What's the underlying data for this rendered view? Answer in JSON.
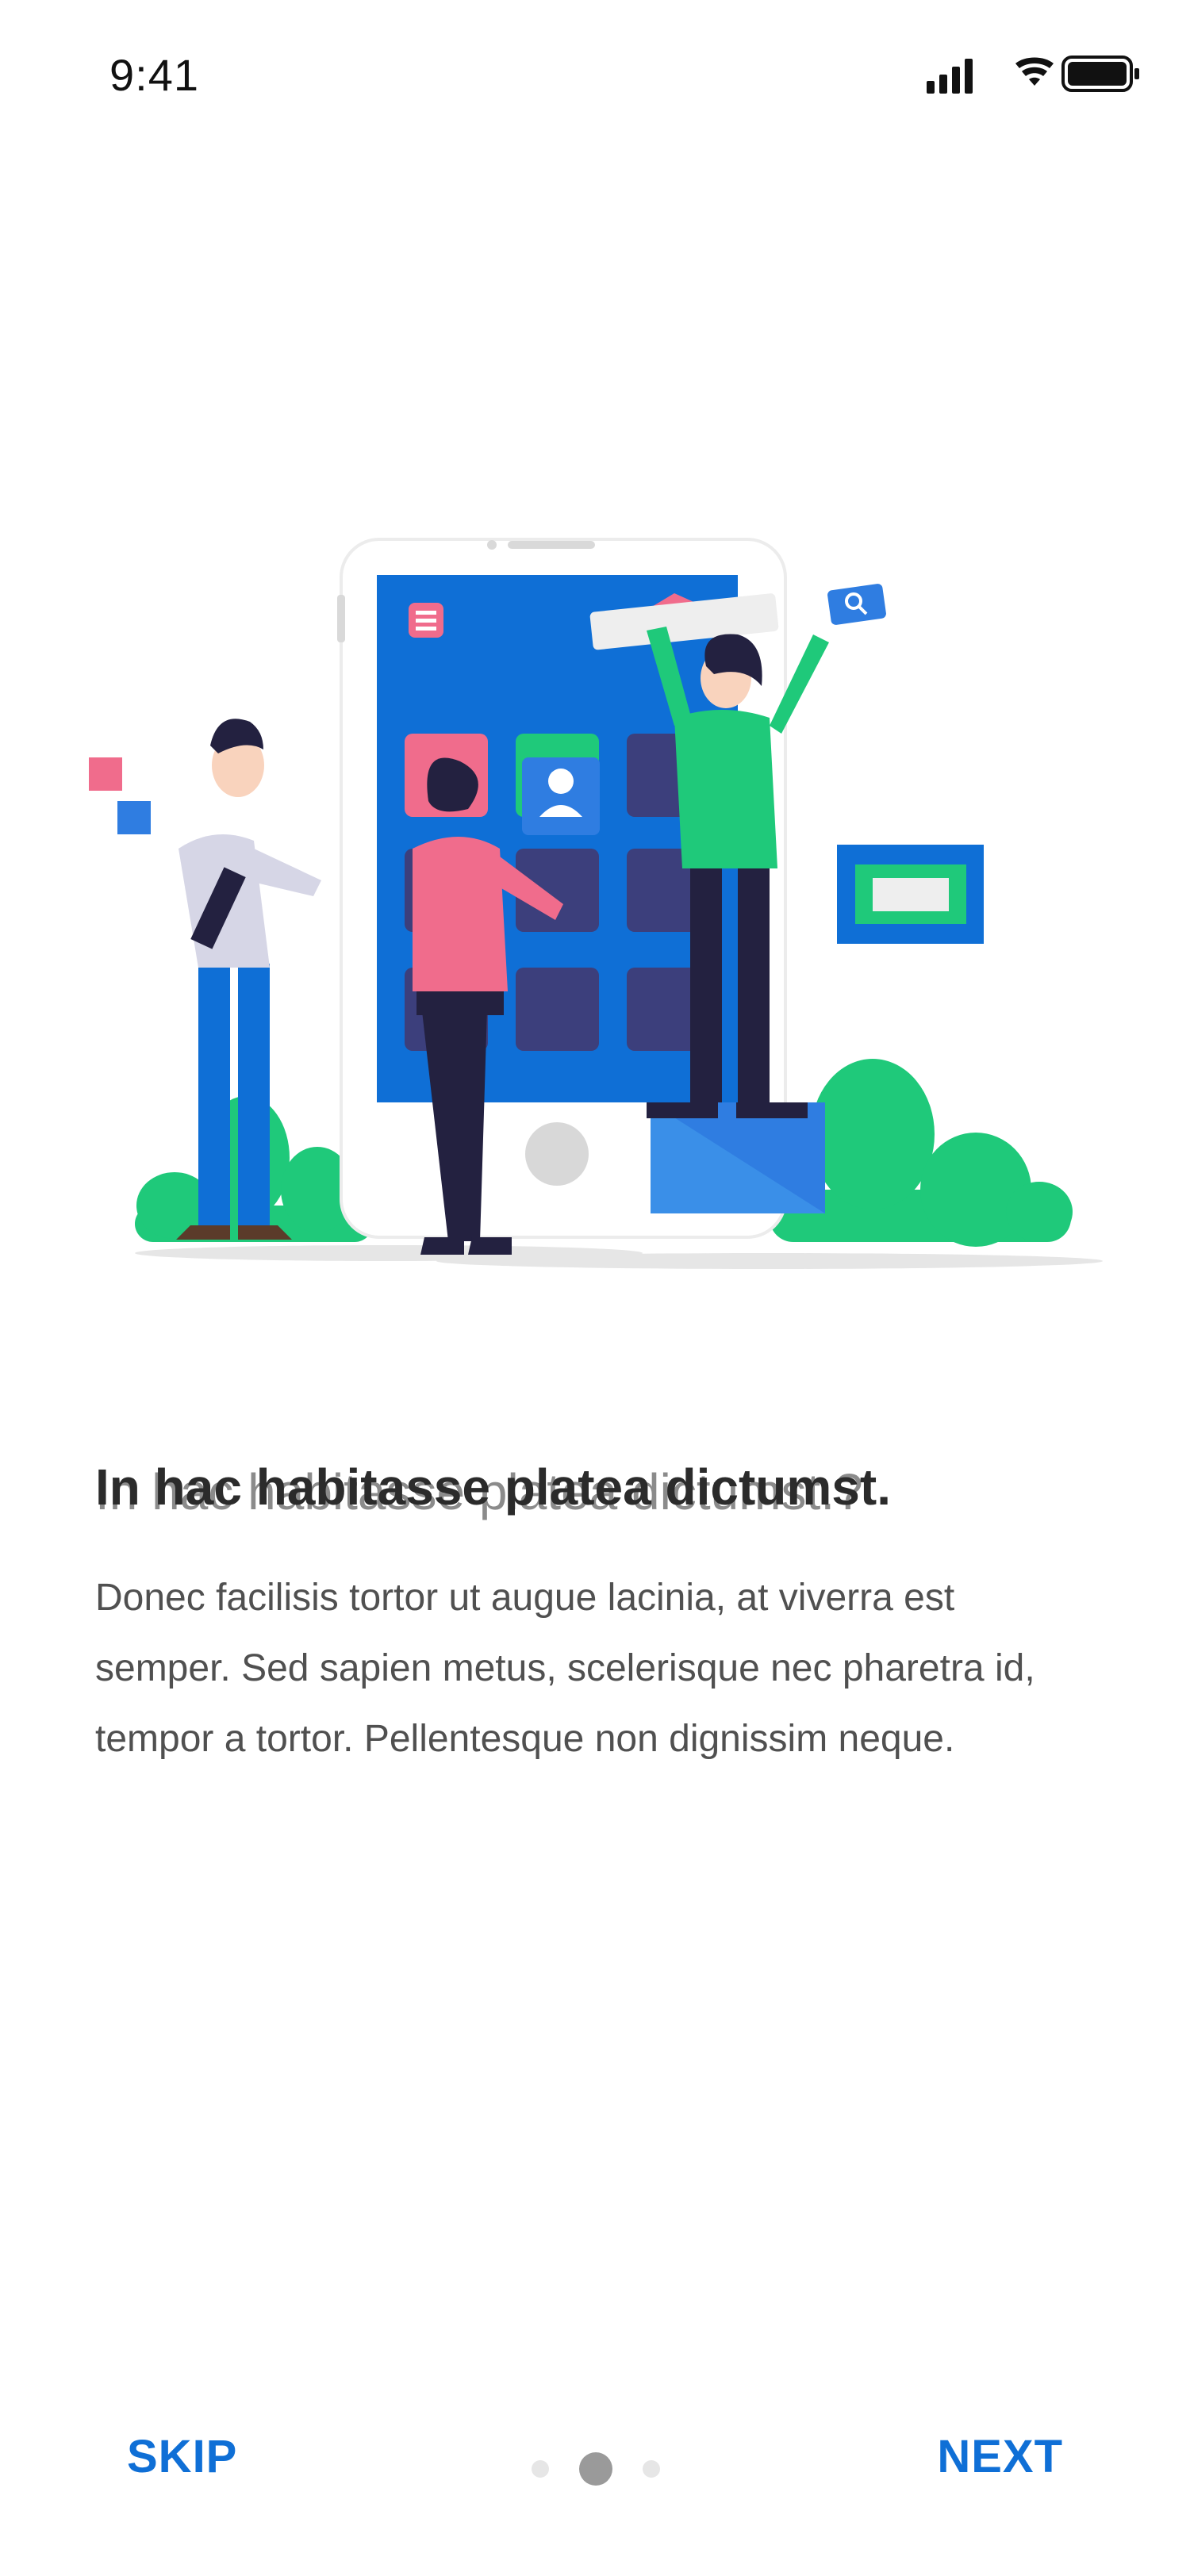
{
  "status": {
    "time": "9:41",
    "icons": [
      "cellular-signal-icon",
      "wifi-icon",
      "battery-icon"
    ]
  },
  "onboarding": {
    "title": "In hac habitasse platea dictumst.",
    "title_overlay": "In hac habitasse platea dictumst.?",
    "body": "Donec facilisis tortor ut augue lacinia, at viverra est semper. Sed sapien metus, scelerisque nec pharetra id, tempor a tortor. Pellentesque non dignissim neque."
  },
  "controls": {
    "skip_label": "SKIP",
    "next_label": "NEXT",
    "pager": {
      "total": 3,
      "active": 2
    }
  },
  "colors": {
    "accent": "#0F6FD6",
    "phone_blue": "#0F6FD6",
    "green": "#1FC97A",
    "pink": "#F06C8C",
    "navy": "#232140"
  }
}
